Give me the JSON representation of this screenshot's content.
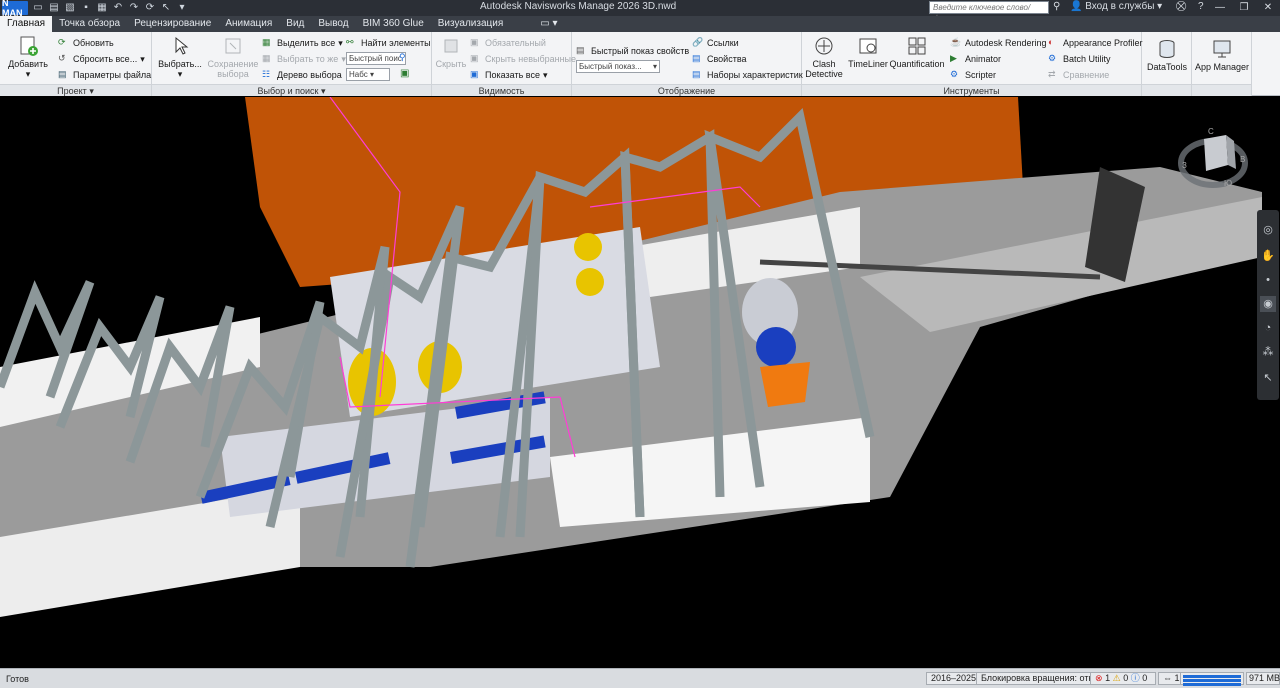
{
  "app": {
    "logo_text": "N MAN",
    "title": "Autodesk Navisworks Manage 2026    3D.nwd",
    "search_placeholder": "Введите ключевое слово/фразу",
    "signin": "Вход в службы"
  },
  "tabs": [
    "Главная",
    "Точка обзора",
    "Рецензирование",
    "Анимация",
    "Вид",
    "Вывод",
    "BIM 360 Glue",
    "Визуализация"
  ],
  "ribbon": {
    "project": {
      "title": "Проект",
      "add": "Добавить",
      "refresh": "Обновить",
      "reset_all": "Сбросить все...",
      "file_options": "Параметры файла"
    },
    "select_search": {
      "title": "Выбор и поиск",
      "select": "Выбрать...",
      "save_selection_line1": "Сохранение",
      "save_selection_line2": "выбора",
      "select_all": "Выделить все",
      "select_same": "Выбрать то же",
      "selection_tree": "Дерево выбора",
      "find_items": "Найти элементы",
      "quick_find_placeholder": "Быстрый поис",
      "sets_label": "Набс"
    },
    "visibility": {
      "title": "Видимость",
      "hide": "Скрыть",
      "required": "Обязательный",
      "hide_unselected": "Скрыть невыбранные",
      "show_all": "Показать все"
    },
    "display": {
      "title": "Отображение",
      "quick_properties": "Быстрый  показ свойств",
      "quick_properties_combo": "Быстрый показ...",
      "links": "Ссылки",
      "properties": "Свойства",
      "property_sets": "Наборы характеристик"
    },
    "tools": {
      "title": "Инструменты",
      "clash_line1": "Clash",
      "clash_line2": "Detective",
      "timeliner": "TimeLiner",
      "quantification": "Quantification",
      "autodesk_rendering": "Autodesk Rendering",
      "animator": "Animator",
      "scripter": "Scripter",
      "appearance_profiler": "Appearance Profiler",
      "batch_utility": "Batch Utility",
      "compare": "Сравнение"
    },
    "datatools": "DataTools",
    "app_manager": "App Manager"
  },
  "status": {
    "ready": "Готов",
    "years": "2016–2025",
    "rotation_lock": "Блокировка вращения: откл.",
    "err_count": "1",
    "warn_count": "0",
    "info_count": "0",
    "page": "1",
    "memory": "971 MB"
  },
  "viewcube": {
    "letters": [
      "З",
      "С",
      "Ю",
      "В"
    ]
  },
  "colors": {
    "accent": "#1e6bd6",
    "wall_orange": "#c05306",
    "steel": "#7d8a8c",
    "floor": "#9b9b9b"
  }
}
